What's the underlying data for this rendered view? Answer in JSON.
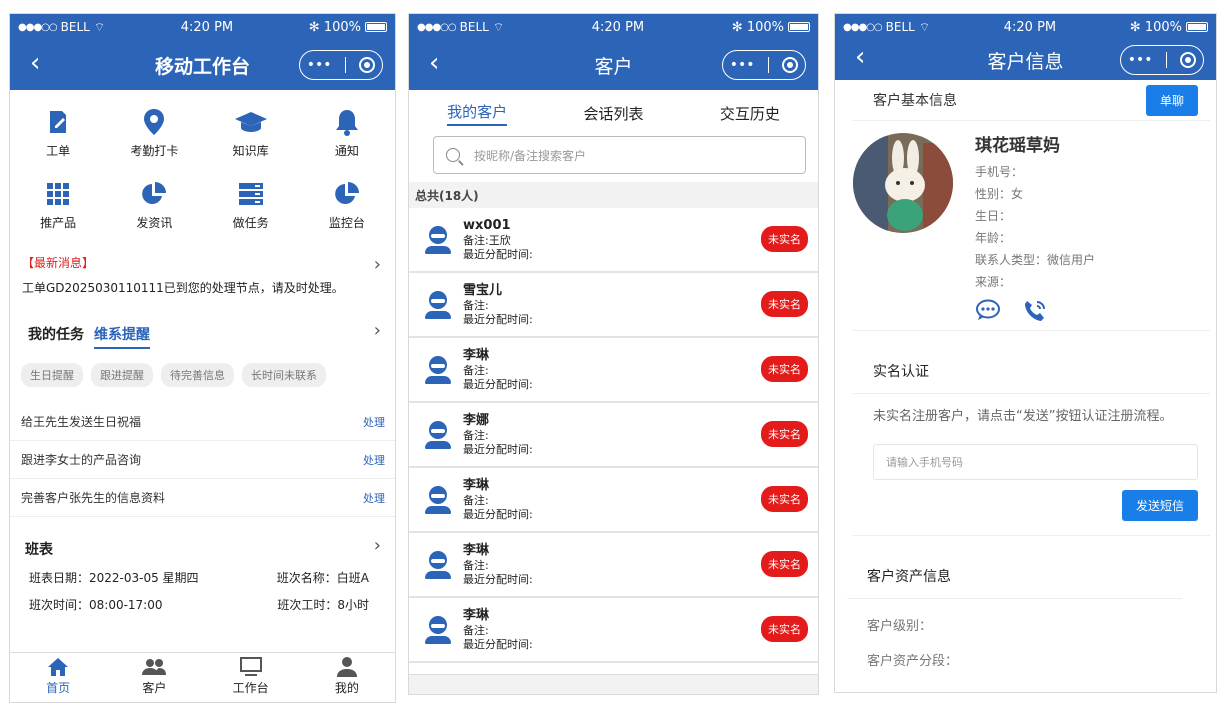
{
  "status": {
    "carrier": "BELL",
    "time": "4:20 PM",
    "battery": "100%"
  },
  "p1": {
    "title": "移动工作台",
    "grid": [
      {
        "label": "工单",
        "icon": "edit-icon"
      },
      {
        "label": "考勤打卡",
        "icon": "location-icon"
      },
      {
        "label": "知识库",
        "icon": "graduation-cap-icon"
      },
      {
        "label": "通知",
        "icon": "bell-icon"
      },
      {
        "label": "推产品",
        "icon": "grid-icon"
      },
      {
        "label": "发资讯",
        "icon": "pie-chart-icon"
      },
      {
        "label": "做任务",
        "icon": "server-icon"
      },
      {
        "label": "监控台",
        "icon": "pie-chart-icon"
      }
    ],
    "news_tag": "【最新消息】",
    "news_msg": "工单GD2025030110111已到您的处理节点，请及时处理。",
    "task_tab": "我的任务",
    "remind_tab": "维系提醒",
    "chips": [
      "生日提醒",
      "跟进提醒",
      "待完善信息",
      "长时间未联系"
    ],
    "todos": [
      {
        "text": "给王先生发送生日祝福",
        "action": "处理"
      },
      {
        "text": "跟进李女士的产品咨询",
        "action": "处理"
      },
      {
        "text": "完善客户张先生的信息资料",
        "action": "处理"
      }
    ],
    "schedule": {
      "title": "班表",
      "date": "班表日期：2022-03-05 星期四",
      "name": "班次名称：白班A",
      "time": "班次时间：08:00-17:00",
      "hours": "班次工时：8小时"
    },
    "tabbar": [
      "首页",
      "客户",
      "工作台",
      "我的"
    ]
  },
  "p2": {
    "title": "客户",
    "seg": [
      "我的客户",
      "会话列表",
      "交互历史"
    ],
    "search_placeholder": "按昵称/备注搜索客户",
    "total": "总共(18人)",
    "assign_label": "最近分配时间:",
    "badge": "未实名",
    "customers": [
      {
        "name": "wx001",
        "note": "备注:王欣"
      },
      {
        "name": "雪宝儿",
        "note": "备注:"
      },
      {
        "name": "李琳",
        "note": "备注:"
      },
      {
        "name": "李娜",
        "note": "备注:"
      },
      {
        "name": "李琳",
        "note": "备注:"
      },
      {
        "name": "李琳",
        "note": "备注:"
      },
      {
        "name": "李琳",
        "note": "备注:"
      }
    ]
  },
  "p3": {
    "title": "客户信息",
    "basic_title": "客户基本信息",
    "chat_btn": "单聊",
    "name": "琪花瑶草妈",
    "fields": [
      "手机号：",
      "性别：女",
      "生日：",
      "年龄：",
      "联系人类型：微信用户",
      "来源："
    ],
    "realname_title": "实名认证",
    "realname_text": "未实名注册客户，请点击“发送”按钮认证注册流程。",
    "phone_placeholder": "请输入手机号码",
    "send_btn": "发送短信",
    "asset_title": "客户资产信息",
    "asset_fields": [
      "客户级别：",
      "客户资产分段："
    ]
  }
}
